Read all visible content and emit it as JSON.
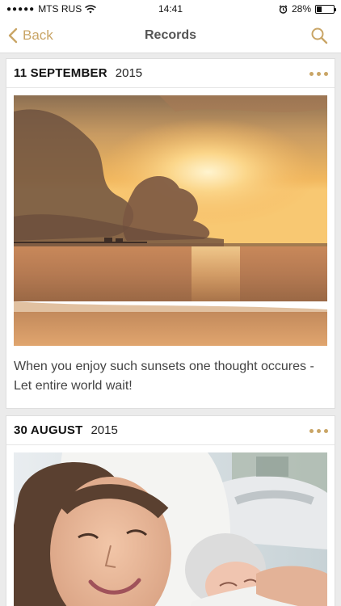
{
  "status_bar": {
    "carrier": "MTS RUS",
    "time": "14:41",
    "battery": "28%",
    "battery_level": 0.28,
    "signal_icon": "signal-dots-icon",
    "wifi_icon": "wifi-icon",
    "alarm_icon": "alarm-icon"
  },
  "nav": {
    "back_label": "Back",
    "title": "Records",
    "search_icon": "search-icon"
  },
  "colors": {
    "accent": "#c9a566",
    "background": "#ebebeb",
    "card": "#ffffff"
  },
  "records": [
    {
      "day": "11 SEPTEMBER",
      "year": "2015",
      "image": "sunset-beach-photo",
      "text": "When you enjoy such sunsets one thought occures - Let entire world wait!"
    },
    {
      "day": "30 AUGUST",
      "year": "2015",
      "image": "mother-newborn-photo"
    }
  ]
}
